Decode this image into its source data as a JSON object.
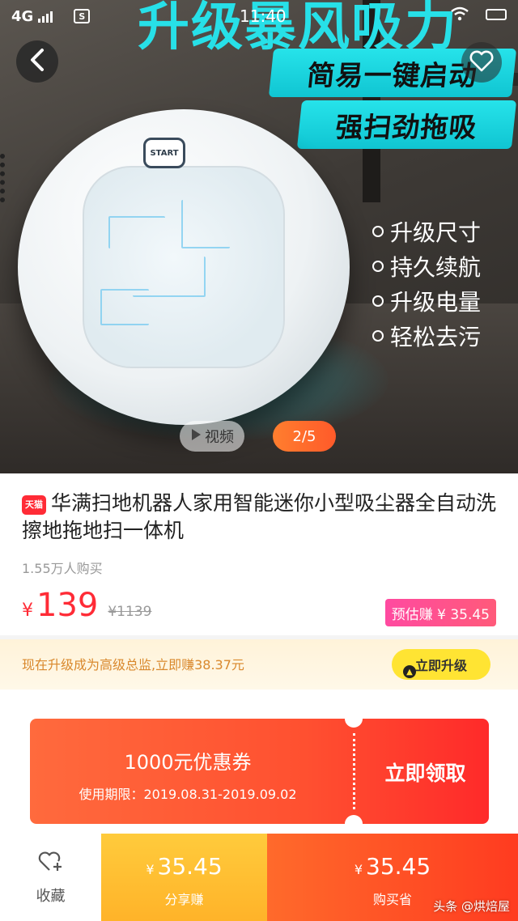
{
  "status_bar": {
    "network": "4G",
    "sim_label": "S",
    "time": "11:40"
  },
  "hero": {
    "banner_text": "升级暴风吸力",
    "pills": [
      "简易一键启动",
      "强扫劲拖吸"
    ],
    "features": [
      "升级尺寸",
      "持久续航",
      "升级电量",
      "轻松去污"
    ],
    "start_label": "START",
    "video_label": "视频",
    "page_indicator": "2/5",
    "icons": {
      "back": "back-arrow-icon",
      "favorite": "heart-plus-icon",
      "play": "play-icon"
    }
  },
  "product": {
    "store_badge": "天猫",
    "title": "华满扫地机器人家用智能迷你小型吸尘器全自动洗擦地拖地扫一体机",
    "sales": "1.55万人购买",
    "price_currency": "¥",
    "price": "139",
    "original_price": "¥1139",
    "estimated_earn": "预估赚 ¥ 35.45"
  },
  "upgrade": {
    "text": "现在升级成为高级总监,立即赚38.37元",
    "button": "立即升级"
  },
  "coupon": {
    "title": "1000元优惠券",
    "period": "使用期限：2019.08.31-2019.09.02",
    "claim": "立即领取"
  },
  "bottom_bar": {
    "favorite_label": "收藏",
    "share": {
      "currency": "¥",
      "amount": "35.45",
      "label": "分享赚"
    },
    "buy": {
      "currency": "¥",
      "amount": "35.45",
      "label": "购买省"
    },
    "watermark": "头条 @烘焙屋"
  },
  "colors": {
    "accent_cyan": "#26e3ea",
    "price_red": "#ff2b36",
    "coupon_orange": "#ff5030",
    "share_yellow": "#ffb329",
    "buy_orange": "#ff3b20"
  }
}
